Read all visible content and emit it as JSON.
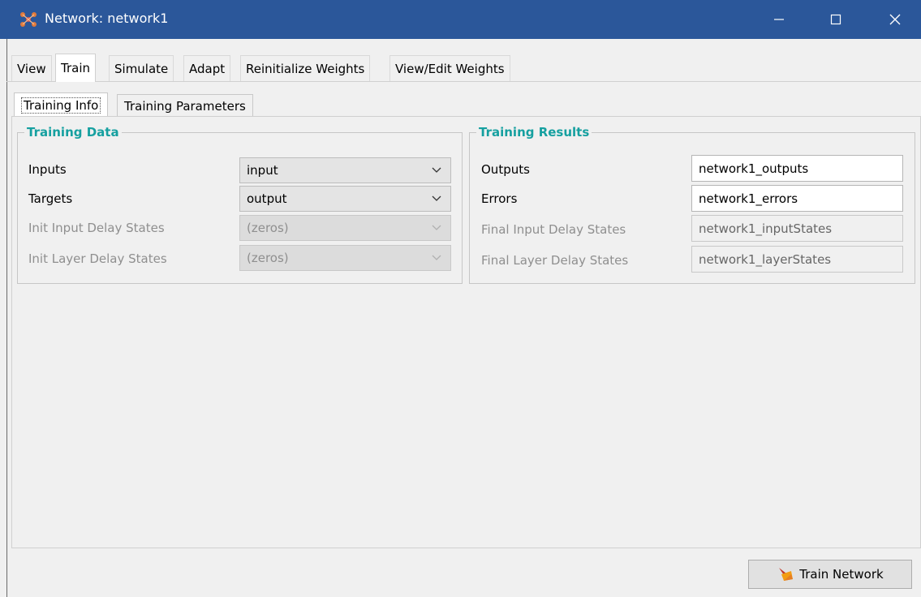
{
  "window": {
    "title": "Network: network1",
    "icon": "network-icon",
    "controls": [
      "minimize-icon",
      "maximize-icon",
      "close-icon"
    ],
    "titlebar_color": "#2b579a"
  },
  "tabs": [
    {
      "label": "View",
      "active": false
    },
    {
      "label": "Train",
      "active": true
    },
    {
      "label": "Simulate",
      "active": false
    },
    {
      "label": "Adapt",
      "active": false
    },
    {
      "label": "Reinitialize Weights",
      "active": false
    },
    {
      "label": "View/Edit Weights",
      "active": false
    }
  ],
  "subtabs": [
    {
      "label": "Training Info",
      "active": true
    },
    {
      "label": "Training Parameters",
      "active": false
    }
  ],
  "training_data": {
    "title": "Training Data",
    "title_color": "#16a0a0",
    "rows": [
      {
        "label": "Inputs",
        "value": "input",
        "enabled": true
      },
      {
        "label": "Targets",
        "value": "output",
        "enabled": true
      },
      {
        "label": "Init Input Delay States",
        "value": "(zeros)",
        "enabled": false
      },
      {
        "label": "Init Layer Delay States",
        "value": "(zeros)",
        "enabled": false
      }
    ]
  },
  "training_results": {
    "title": "Training Results",
    "rows": [
      {
        "label": "Outputs",
        "value": "network1_outputs",
        "enabled": true
      },
      {
        "label": "Errors",
        "value": "network1_errors",
        "enabled": true
      },
      {
        "label": "Final Input Delay States",
        "value": "network1_inputStates",
        "enabled": false
      },
      {
        "label": "Final Layer Delay States",
        "value": "network1_layerStates",
        "enabled": false
      }
    ]
  },
  "train_button": {
    "label": "Train Network",
    "icon": "train-icon"
  }
}
